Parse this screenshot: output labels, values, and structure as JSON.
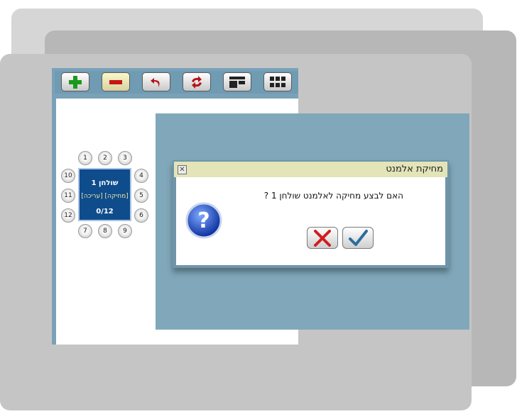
{
  "toolbar": {
    "buttons": [
      {
        "name": "add",
        "icon": "plus-icon",
        "color": "#1a9a1a"
      },
      {
        "name": "remove",
        "icon": "minus-icon",
        "color": "#c41616"
      },
      {
        "name": "undo",
        "icon": "undo-arrow-icon",
        "color": "#b51212"
      },
      {
        "name": "refresh",
        "icon": "refresh-icon",
        "color": "#b51212"
      },
      {
        "name": "layout",
        "icon": "layout-icon",
        "color": "#222222"
      },
      {
        "name": "grid",
        "icon": "grid-icon",
        "color": "#222222"
      }
    ]
  },
  "table": {
    "name": "שולחן 1",
    "actions": "[מחיקה] [עריכה]",
    "count": "0/12",
    "seats": [
      "1",
      "2",
      "3",
      "4",
      "5",
      "6",
      "7",
      "8",
      "9",
      "10",
      "11",
      "12"
    ]
  },
  "dialog": {
    "title": "מחיקת אלמנט",
    "close_icon": "close-icon",
    "message": "האם לבצע מחיקה לאלמנט שולחן 1 ?",
    "question_icon": "question-icon",
    "cancel_icon": "x-mark-icon",
    "confirm_icon": "check-mark-icon"
  }
}
